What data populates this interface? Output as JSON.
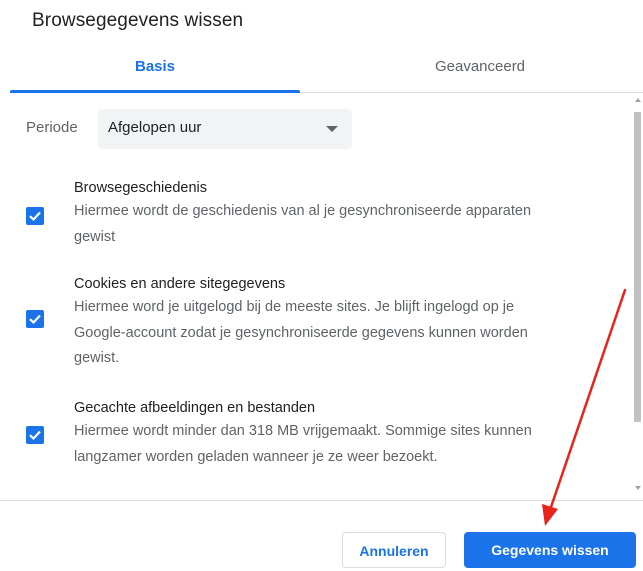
{
  "dialog": {
    "title": "Browsegegevens wissen"
  },
  "tabs": [
    {
      "label": "Basis",
      "active": true
    },
    {
      "label": "Geavanceerd",
      "active": false
    }
  ],
  "period": {
    "label": "Periode",
    "selected": "Afgelopen uur"
  },
  "items": [
    {
      "title": "Browsegeschiedenis",
      "description_lines": [
        "Hiermee wordt de geschiedenis van al je gesynchroniseerde apparaten",
        "gewist"
      ],
      "checked": true
    },
    {
      "title": "Cookies en andere sitegegevens",
      "description_lines": [
        "Hiermee word je uitgelogd bij de meeste sites. Je blijft ingelogd op je",
        "Google-account zodat je gesynchroniseerde gegevens kunnen worden",
        "gewist."
      ],
      "checked": true
    },
    {
      "title": "Gecachte afbeeldingen en bestanden",
      "description_lines": [
        "Hiermee wordt minder dan 318 MB vrijgemaakt. Sommige sites kunnen",
        "langzamer worden geladen wanneer je ze weer bezoekt."
      ],
      "checked": true
    }
  ],
  "buttons": {
    "cancel": "Annuleren",
    "clear": "Gegevens wissen"
  },
  "colors": {
    "accent": "#1a73e8",
    "annotation_arrow": "#e8231c"
  },
  "icons": {
    "checkbox": "check-icon",
    "dropdown": "caret-down-icon"
  }
}
